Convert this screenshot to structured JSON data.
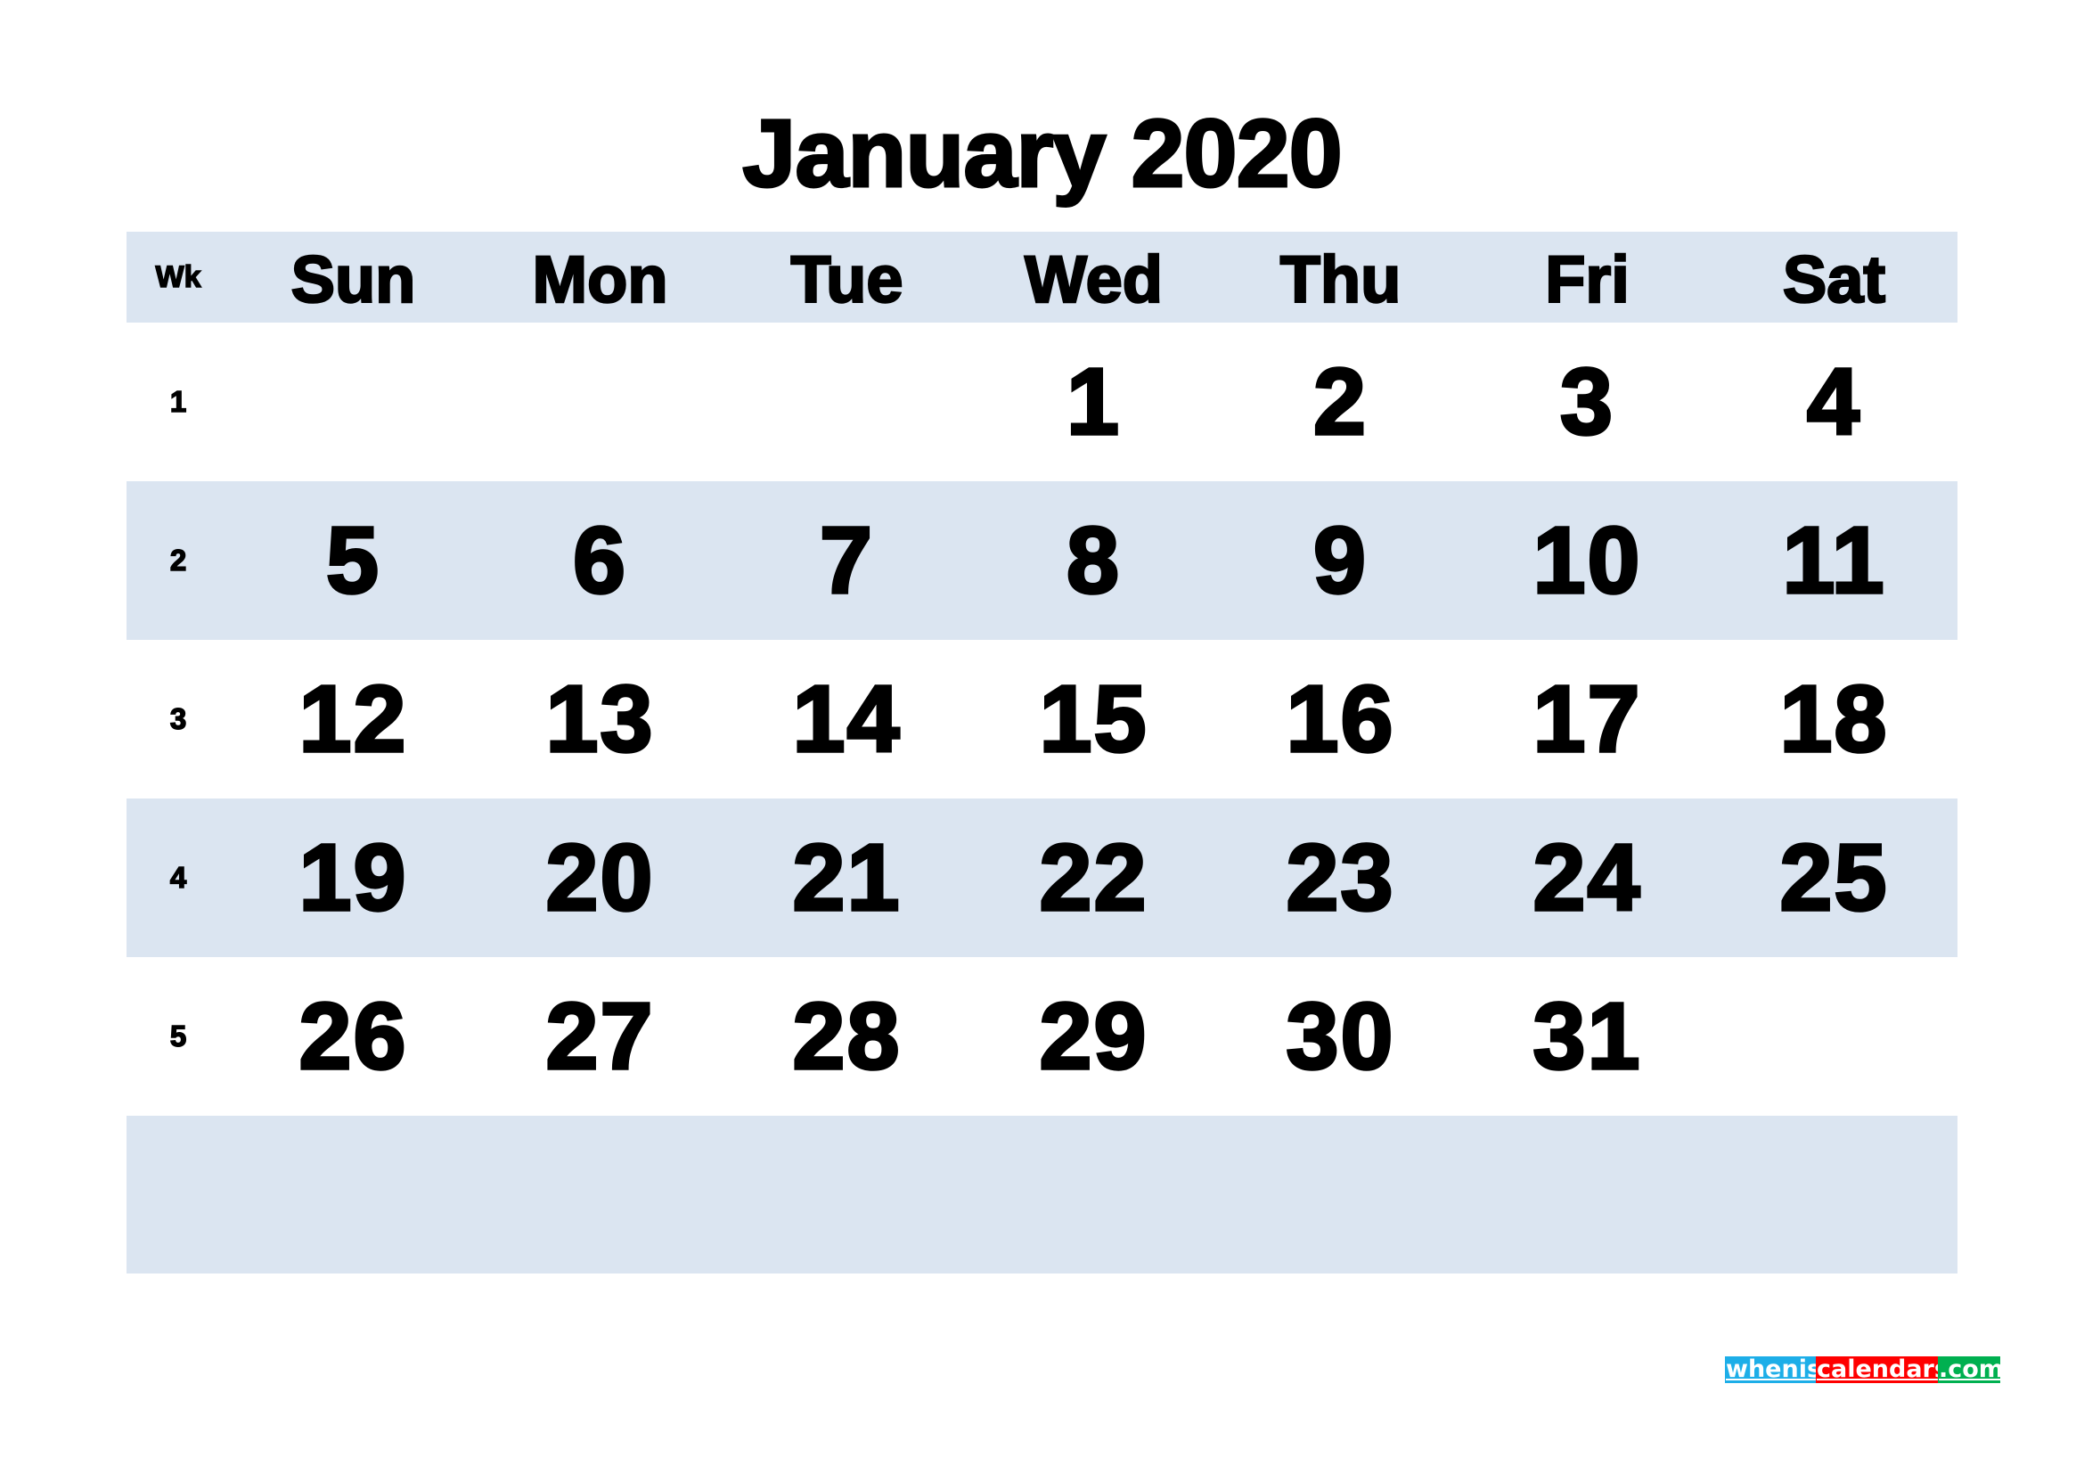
{
  "title": "January 2020",
  "header": {
    "week_label": "Wk",
    "days": [
      "Sun",
      "Mon",
      "Tue",
      "Wed",
      "Thu",
      "Fri",
      "Sat"
    ]
  },
  "weeks": [
    {
      "week": "1",
      "days": [
        "",
        "",
        "",
        "1",
        "2",
        "3",
        "4"
      ]
    },
    {
      "week": "2",
      "days": [
        "5",
        "6",
        "7",
        "8",
        "9",
        "10",
        "11"
      ]
    },
    {
      "week": "3",
      "days": [
        "12",
        "13",
        "14",
        "15",
        "16",
        "17",
        "18"
      ]
    },
    {
      "week": "4",
      "days": [
        "19",
        "20",
        "21",
        "22",
        "23",
        "24",
        "25"
      ]
    },
    {
      "week": "5",
      "days": [
        "26",
        "27",
        "28",
        "29",
        "30",
        "31",
        ""
      ]
    },
    {
      "week": "",
      "days": [
        "",
        "",
        "",
        "",
        "",
        "",
        ""
      ]
    }
  ],
  "logo": {
    "part1": "whenis",
    "part2": "calendars",
    "part3": ".com"
  },
  "colors": {
    "band": "#dbe5f1",
    "logo_blue": "#1daee8",
    "logo_red": "#ff0000",
    "logo_green": "#00b050"
  }
}
